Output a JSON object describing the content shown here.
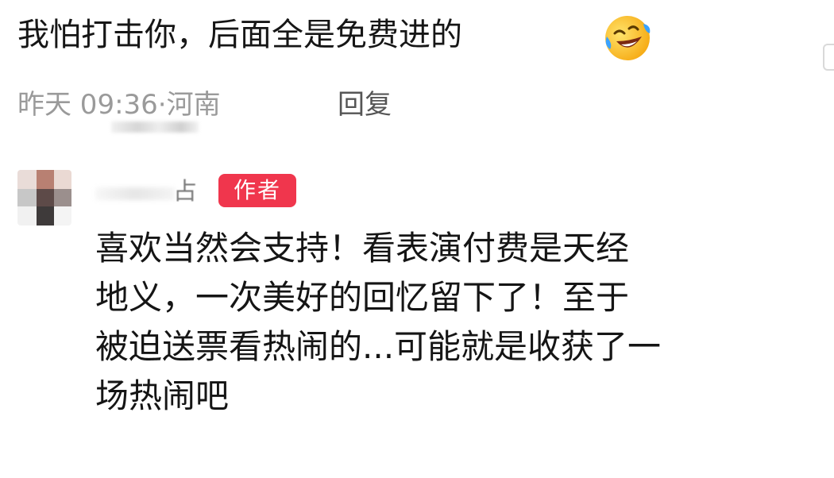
{
  "comment": {
    "text": "我怕打击你，后面全是免费进的",
    "emoji": "rolling-on-floor-laughing-emoji"
  },
  "meta": {
    "time": "昨天 09:36",
    "separator": "·",
    "location": "河南",
    "reply_label": "回复"
  },
  "reply": {
    "username_tail": "占",
    "badge": "作者",
    "lines": [
      "喜欢当然会支持！看表演付费是天经",
      "地义，一次美好的回忆留下了！至于",
      "被迫送票看热闹的...可能就是收获了一",
      "场热闹吧"
    ]
  },
  "colors": {
    "badge_bg": "#f0364d",
    "meta_text": "#9a9a9a",
    "reply_label": "#555555"
  }
}
